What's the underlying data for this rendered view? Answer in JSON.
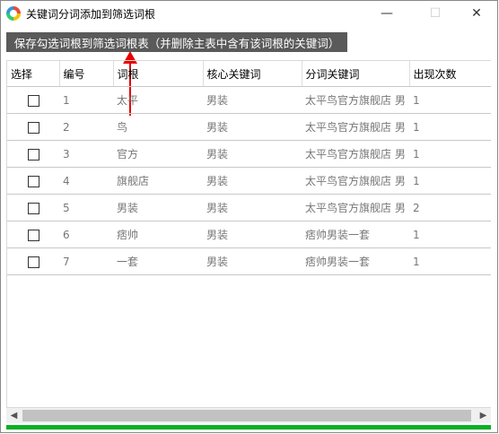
{
  "window": {
    "title": "关键词分词添加到筛选词根",
    "minimize": "—",
    "maximize": "☐",
    "close": "✕"
  },
  "toolbar": {
    "save_label": "保存勾选词根到筛选词根表（并删除主表中含有该词根的关键词）"
  },
  "table": {
    "headers": [
      "选择",
      "编号",
      "词根",
      "核心关键词",
      "分词关键词",
      "出现次数"
    ],
    "rows": [
      [
        "1",
        "太平",
        "男装",
        "太平鸟官方旗舰店 男",
        "1"
      ],
      [
        "2",
        "鸟",
        "男装",
        "太平鸟官方旗舰店 男",
        "1"
      ],
      [
        "3",
        "官方",
        "男装",
        "太平鸟官方旗舰店 男",
        "1"
      ],
      [
        "4",
        "旗舰店",
        "男装",
        "太平鸟官方旗舰店 男",
        "1"
      ],
      [
        "5",
        "男装",
        "男装",
        "太平鸟官方旗舰店 男",
        "2"
      ],
      [
        "6",
        "痞帅",
        "男装",
        "痞帅男装一套",
        "1"
      ],
      [
        "7",
        "一套",
        "男装",
        "痞帅男装一套",
        "1"
      ]
    ]
  },
  "scrollbar": {
    "left": "◀",
    "right": "▶"
  },
  "progress": {
    "value_percent": 100,
    "color": "#06b025"
  },
  "annotation": {
    "arrow_color": "#e60000",
    "icon": "arrow-up-icon"
  }
}
